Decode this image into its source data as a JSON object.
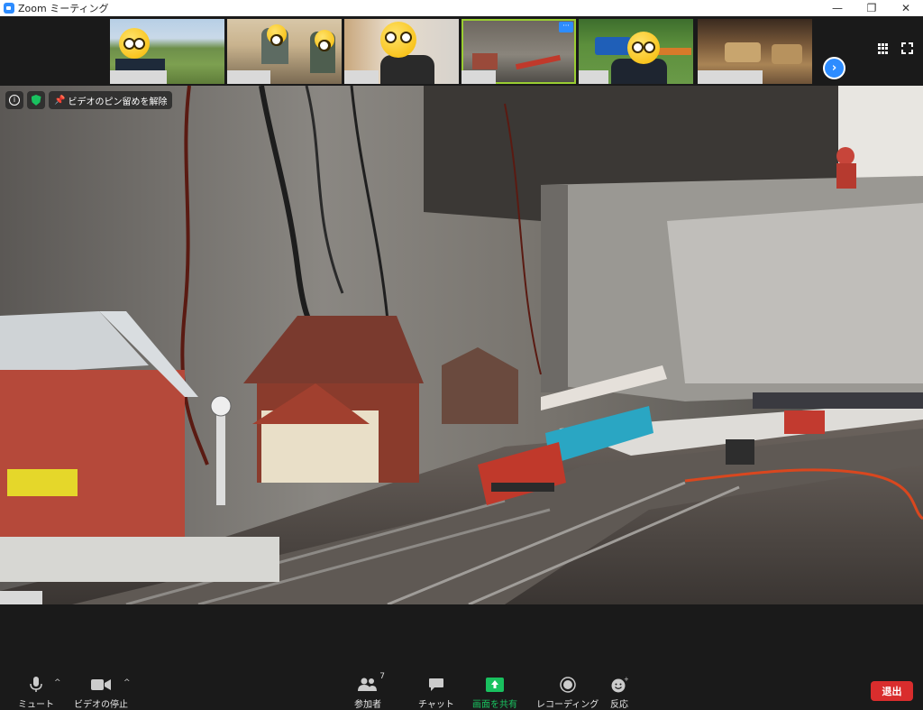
{
  "window": {
    "title": "Zoom ミーティング",
    "minimize": "—",
    "restore": "❐",
    "close": "✕"
  },
  "thumbnails": [
    {
      "name": "",
      "emoji": "glasses"
    },
    {
      "name": "",
      "emoji": "neutral"
    },
    {
      "name": "",
      "emoji": "surprised"
    },
    {
      "name": "",
      "emoji": "none",
      "active": true
    },
    {
      "name": "",
      "emoji": "thinking"
    },
    {
      "name": "",
      "emoji": "none"
    }
  ],
  "thumb_more_label": "···",
  "next_page_label": "›",
  "main": {
    "unpin_label": "ビデオのピン留めを解除",
    "info_label": "i"
  },
  "toolbar": {
    "mute_label": "ミュート",
    "video_label": "ビデオの停止",
    "participants_label": "参加者",
    "participants_count": "7",
    "chat_label": "チャット",
    "share_label": "画面を共有",
    "record_label": "レコーディング",
    "reactions_label": "反応",
    "leave_label": "退出",
    "caret": "^"
  },
  "colors": {
    "accent": "#2d8cff",
    "share_green": "#19c15f",
    "leave_red": "#d92d2d"
  }
}
